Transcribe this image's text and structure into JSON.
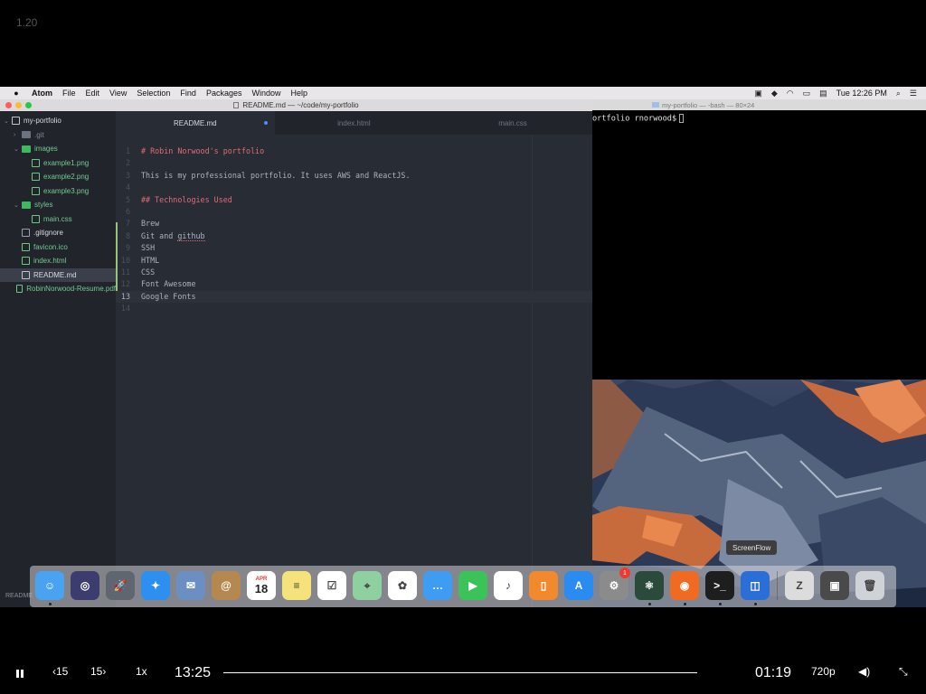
{
  "overlay_label": "1.20",
  "menubar": {
    "apple": "",
    "items": [
      "Atom",
      "File",
      "Edit",
      "View",
      "Selection",
      "Find",
      "Packages",
      "Window",
      "Help"
    ],
    "clock": "Tue 12:26 PM"
  },
  "atom": {
    "window_title": "README.md — ~/code/my-portfolio",
    "tree": [
      {
        "label": "my-portfolio",
        "indent": 0,
        "kind": "project",
        "twisty": "⌄"
      },
      {
        "label": ".git",
        "indent": 1,
        "kind": "folder-grey",
        "twisty": "›"
      },
      {
        "label": "images",
        "indent": 1,
        "kind": "folder",
        "twisty": "⌄"
      },
      {
        "label": "example1.png",
        "indent": 2,
        "kind": "image"
      },
      {
        "label": "example2.png",
        "indent": 2,
        "kind": "image"
      },
      {
        "label": "example3.png",
        "indent": 2,
        "kind": "image"
      },
      {
        "label": "styles",
        "indent": 1,
        "kind": "folder",
        "twisty": "⌄"
      },
      {
        "label": "main.css",
        "indent": 2,
        "kind": "file-green"
      },
      {
        "label": ".gitignore",
        "indent": 1,
        "kind": "file-grey"
      },
      {
        "label": "favicon.ico",
        "indent": 1,
        "kind": "image"
      },
      {
        "label": "index.html",
        "indent": 1,
        "kind": "file-green"
      },
      {
        "label": "README.md",
        "indent": 1,
        "kind": "doc",
        "selected": true
      },
      {
        "label": "RobinNorwood-Resume.pdf",
        "indent": 1,
        "kind": "pdf"
      }
    ],
    "tabs": [
      {
        "label": "README.md",
        "active": true,
        "modified": true
      },
      {
        "label": "index.html",
        "active": false
      },
      {
        "label": "main.css",
        "active": false
      }
    ],
    "lines": [
      {
        "n": "1",
        "text": "# Robin Norwood's portfolio",
        "heading": true
      },
      {
        "n": "2",
        "text": ""
      },
      {
        "n": "3",
        "text": "This is my professional portfolio. It uses AWS and ReactJS."
      },
      {
        "n": "4",
        "text": ""
      },
      {
        "n": "5",
        "text": "## Technologies Used",
        "heading": true
      },
      {
        "n": "6",
        "text": ""
      },
      {
        "n": "7",
        "text": "Brew"
      },
      {
        "n": "8",
        "text": "Git and github"
      },
      {
        "n": "9",
        "text": "SSH"
      },
      {
        "n": "10",
        "text": "HTML"
      },
      {
        "n": "11",
        "text": "CSS"
      },
      {
        "n": "12",
        "text": "Font Awesome"
      },
      {
        "n": "13",
        "text": "Google Fonts",
        "current": true
      },
      {
        "n": "14",
        "text": ""
      }
    ],
    "status_peek": "README"
  },
  "terminal": {
    "title": "my-portfolio — -bash — 80×24",
    "prompt": "ortfolio rnorwood$"
  },
  "dock": {
    "tooltip": "ScreenFlow",
    "badge": "1",
    "calendar_month": "APR",
    "calendar_day": "18",
    "icons": [
      "Finder",
      "Siri",
      "Launchpad",
      "Safari",
      "Mail",
      "Contacts",
      "Calendar",
      "Notes",
      "Reminders",
      "Maps",
      "Photos",
      "Messages",
      "FaceTime",
      "iTunes",
      "iBooks",
      "App Store",
      "System Preferences",
      "Atom",
      "Firefox",
      "Terminal",
      "ScreenFlow",
      "Archive",
      "Preview",
      "Trash"
    ]
  },
  "player": {
    "pause_label": "pause",
    "back_label": "15",
    "forward_label": "15",
    "speed": "1x",
    "elapsed": "13:25",
    "remaining": "01:19",
    "quality": "720p",
    "progress": 1.0
  },
  "colors": {
    "accent_blue": "#528bff",
    "heading_red": "#e06c75",
    "tree_green": "#73c990"
  }
}
